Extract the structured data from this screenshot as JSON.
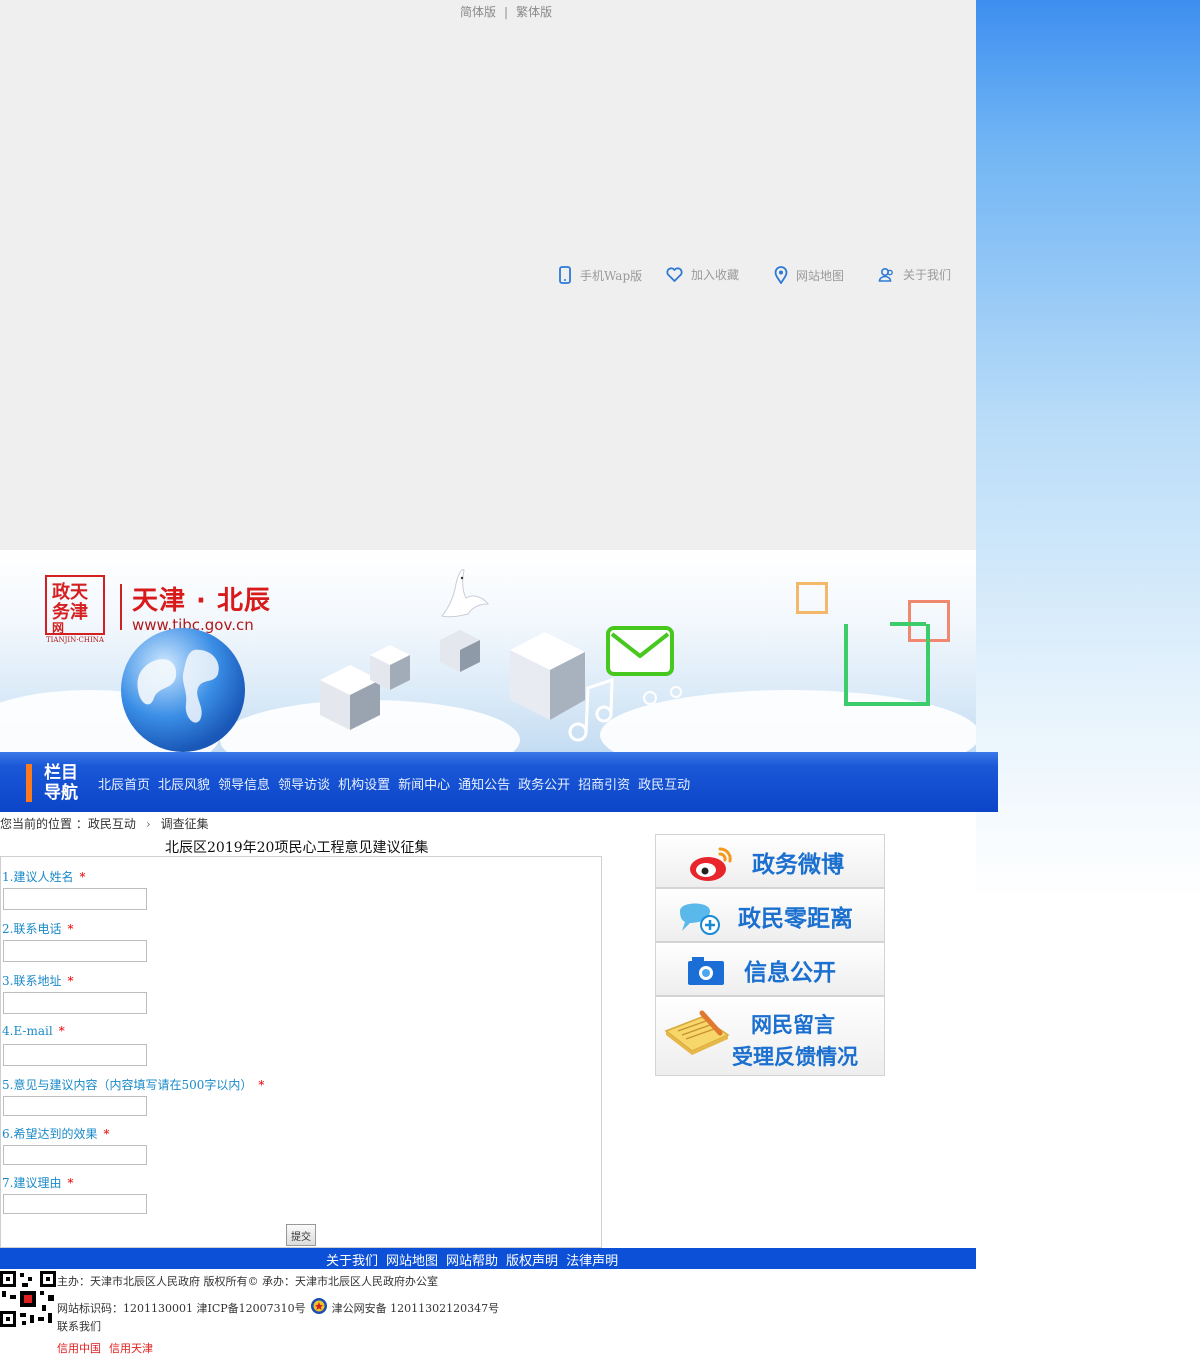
{
  "header": {
    "lang_simplified": "简体版",
    "lang_separator": "|",
    "lang_traditional": "繁体版",
    "tools": [
      {
        "label": "手机Wap版",
        "icon": "mobile-phone-icon"
      },
      {
        "label": "加入收藏",
        "icon": "heart-icon"
      },
      {
        "label": "网站地图",
        "icon": "map-pin-icon"
      },
      {
        "label": "关于我们",
        "icon": "users-icon"
      }
    ]
  },
  "banner": {
    "seal_text": "政天\n务津\n网",
    "seal_subtitle": "TIANJIN·CHINA",
    "title": "天津 · 北辰",
    "url": "www.tjbc.gov.cn"
  },
  "nav": {
    "title_line1": "栏目",
    "title_line2": "导航",
    "items": [
      "北辰首页",
      "北辰风貌",
      "领导信息",
      "领导访谈",
      "机构设置",
      "新闻中心",
      "通知公告",
      "政务公开",
      "招商引资",
      "政民互动"
    ]
  },
  "breadcrumb": {
    "prefix": "您当前的位置 ：",
    "level1": "政民互动",
    "arrow": "›",
    "level2": "调查征集"
  },
  "form": {
    "title": "北辰区2019年20项民心工程意见建议征集",
    "required_mark": "*",
    "questions": [
      {
        "label": "1.建议人姓名",
        "value": ""
      },
      {
        "label": "2.联系电话",
        "value": ""
      },
      {
        "label": "3.联系地址",
        "value": ""
      },
      {
        "label": "4.E-mail",
        "value": ""
      },
      {
        "label": "5.意见与建议内容（内容填写请在500字以内）",
        "value": ""
      },
      {
        "label": "6.希望达到的效果",
        "value": ""
      },
      {
        "label": "7.建议理由",
        "value": ""
      }
    ],
    "submit_label": "提交"
  },
  "side_panels": [
    {
      "label": "政务微博",
      "icon": "weibo-icon"
    },
    {
      "label": "政民零距离",
      "icon": "chat-bubble-icon"
    },
    {
      "label": "信息公开",
      "icon": "camera-folder-icon"
    },
    {
      "label_line1": "网民留言",
      "label_line2": "受理反馈情况",
      "icon": "notebook-pen-icon"
    }
  ],
  "footer": {
    "links": [
      "关于我们",
      "网站地图",
      "网站帮助",
      "版权声明",
      "法律声明"
    ],
    "line1": "主办：天津市北辰区人民政府  版权所有©  承办：天津市北辰区人民政府办公室",
    "line2_a": "网站标识码：1201130001  津ICP备12007310号",
    "line2_b": "津公网安备  12011302120347号",
    "line3": "联系我们",
    "red_links": [
      "信用中国",
      "信用天津"
    ]
  },
  "colors": {
    "nav_blue": "#0b44c8",
    "accent_orange": "#ff7a1a",
    "label_blue": "#1a8ac8",
    "required_red": "#ee0000",
    "footer_blue": "#0d50d8"
  }
}
